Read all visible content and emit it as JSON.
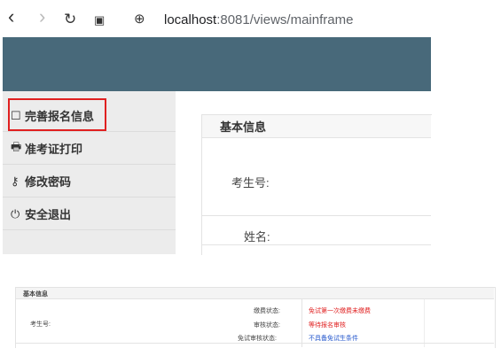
{
  "browser": {
    "back_icon": "‹",
    "forward_icon": "›",
    "reload_icon": "↻",
    "tabs_icon": "▣",
    "site_icon": "⊕",
    "url_host": "localhost",
    "url_rest": ":8081/views/mainframe"
  },
  "sidebar": {
    "items": [
      {
        "icon": "☐",
        "label": "完善报名信息"
      },
      {
        "icon": "🖶",
        "label": "准考证打印"
      },
      {
        "icon": "⚷",
        "label": "修改密码"
      },
      {
        "icon": "⏻",
        "label": "安全退出"
      }
    ]
  },
  "main": {
    "panel_title": "基本信息",
    "exam_no_label": "考生号:",
    "name_label": "姓名:"
  },
  "thumbnail": {
    "panel_title": "基本信息",
    "exam_no_label": "考生号:",
    "rows": [
      {
        "label": "缴费状态:",
        "value": "免试第一次缴费未缴费"
      },
      {
        "label": "审核状态:",
        "value": "等待报名审核"
      },
      {
        "label": "免试审核状态:",
        "value": "不具备免试生条件"
      }
    ]
  },
  "colors": {
    "topbar": "#48697a",
    "highlight": "#e02020",
    "status_red": "#e02020",
    "status_blue": "#2255cc"
  }
}
